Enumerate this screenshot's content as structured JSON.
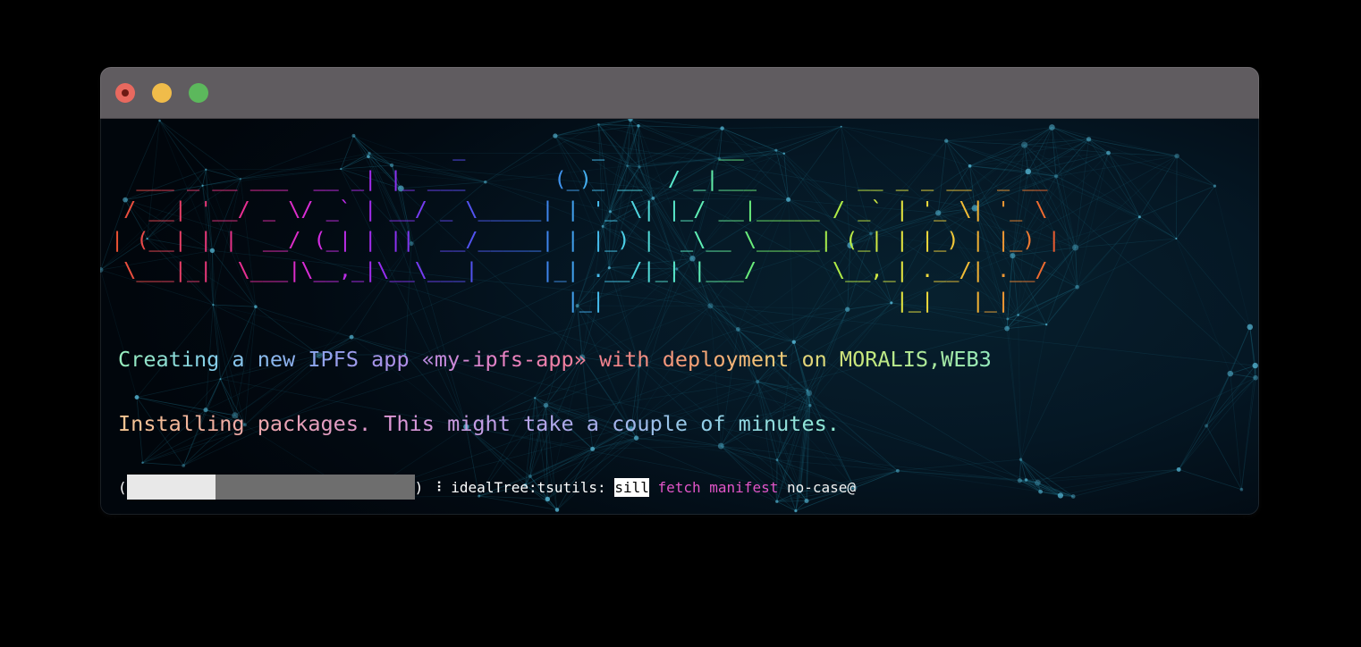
{
  "window": {
    "title": "",
    "controls": [
      {
        "name": "close",
        "color": "#e8695f"
      },
      {
        "name": "minimize",
        "color": "#f0bc4a"
      },
      {
        "name": "zoom",
        "color": "#5cb85c"
      }
    ]
  },
  "banner": {
    "text_value": "create-ipfs-app",
    "font_style": "figlet-standard",
    "lines": [
      "                           _          _         __                        ",
      "  ___ _ __ ___  __ _| |_ ___       (_)_ __  / _|___        __ _ _ __  _ __  ",
      " / __| '__/ _ \\/ _` | __/ _ \\_____| | '_ \\| |_/ __|_____ / _` | '_ \\| '_ \\ ",
      "| (__| | |  __/ (_| | ||  __/_____| | |_) |  _\\__ \\_____| (_| | |_) | |_) |",
      " \\___|_|  \\___|\\__,_|\\__\\___|     |_| .__/|_| |___/      \\__,_| .__/| .__/ ",
      "                                    |_|                       |_|   |_|    "
    ]
  },
  "messages": {
    "creating": "Creating a new IPFS app «my-ipfs-app» with deployment on MORALIS,WEB3",
    "installing": "Installing packages. This might take a couple of minutes."
  },
  "progress": {
    "open_paren": "(",
    "close_paren": ")",
    "separator": "⠸",
    "percent": 31,
    "bar_filled_color": "#e8e8e8",
    "bar_track_color": "#6e6e6e",
    "task": "idealTree:tsutils:",
    "level": "sill",
    "action": "fetch manifest",
    "package": "no-case@"
  },
  "colors": {
    "titlebar": "#605c60",
    "terminal_bg": "#051724",
    "network_line": "#1d6f86",
    "network_dot": "#5fc8e8",
    "highlight_bg": "#ffffff",
    "highlight_fg": "#000000",
    "magenta": "#e255c8",
    "white": "#f2f2f2"
  }
}
